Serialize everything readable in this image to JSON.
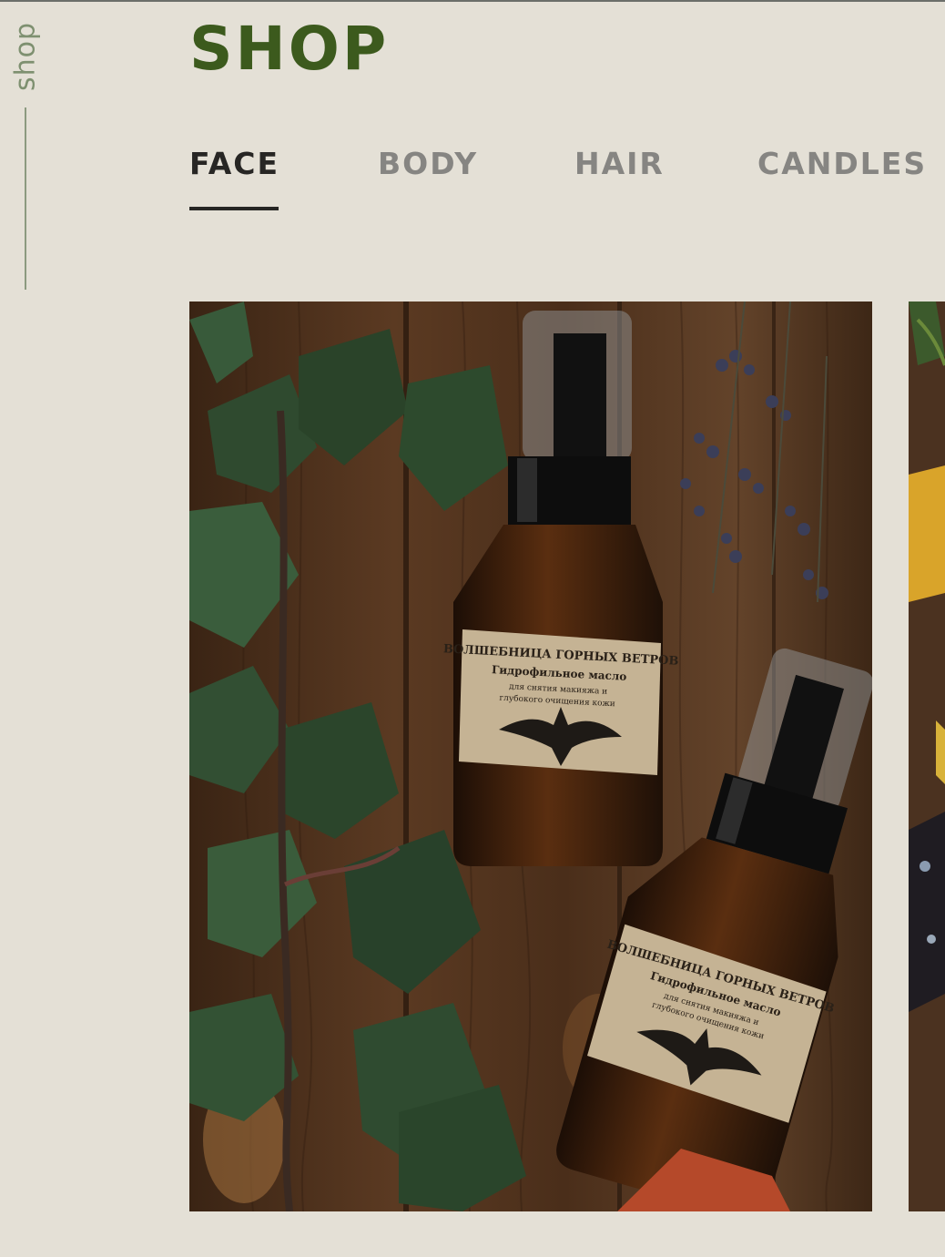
{
  "sidebar": {
    "label": "shop"
  },
  "page": {
    "title": "SHOP"
  },
  "tabs": [
    {
      "label": "FACE",
      "active": true
    },
    {
      "label": "BODY",
      "active": false
    },
    {
      "label": "HAIR",
      "active": false
    },
    {
      "label": "CANDLES",
      "active": false
    }
  ],
  "product": {
    "label_brand": "ВОЛШЕБНИЦА ГОРНЫХ ВЕТРОВ",
    "label_name": "Гидрофильное масло",
    "label_desc_1": "для снятия макияжа и",
    "label_desc_2": "глубокого очищения кожи"
  },
  "colors": {
    "title": "#3c5a1d",
    "background": "#e4e0d6",
    "tab_active": "#272624",
    "tab_inactive": "#868582"
  }
}
